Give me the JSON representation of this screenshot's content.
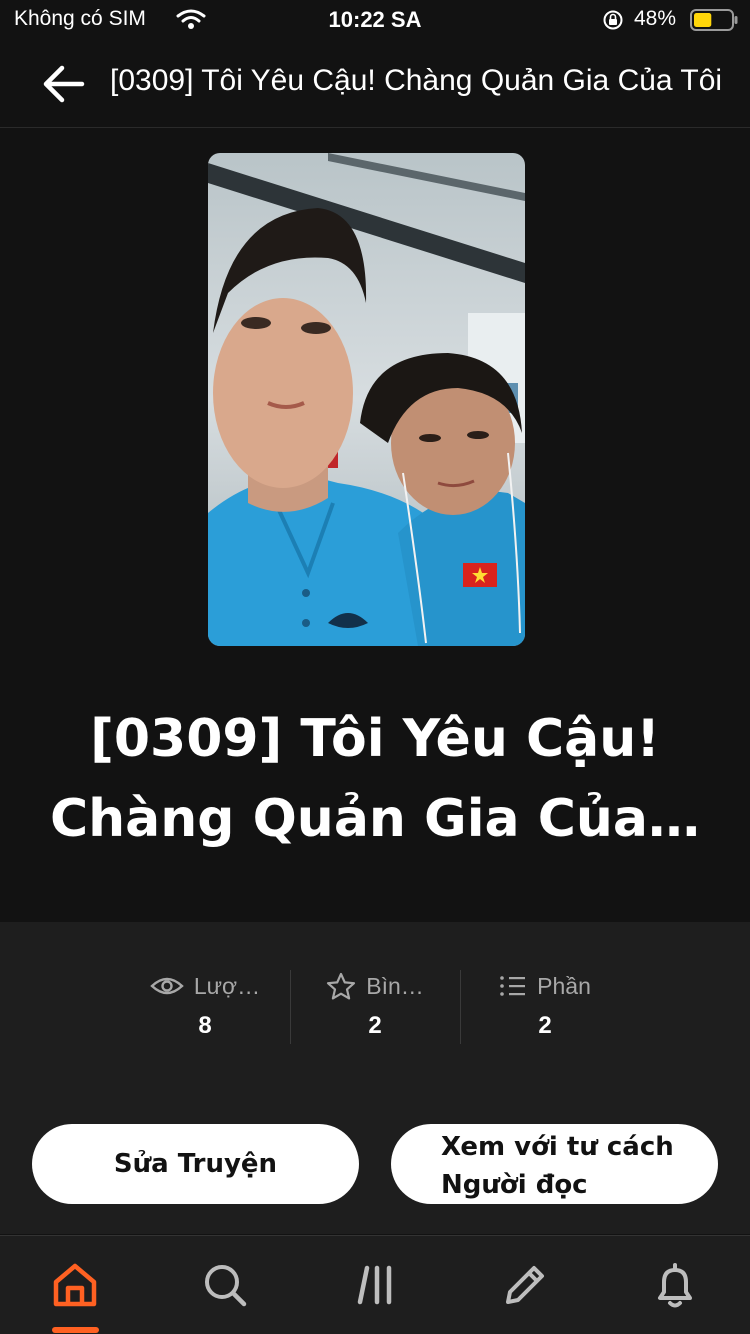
{
  "status_bar": {
    "carrier": "Không có SIM",
    "time": "10:22 SA",
    "battery_percent": "48%",
    "battery_level": 0.48,
    "battery_color": "#ffd60a"
  },
  "nav": {
    "title": "[0309] Tôi Yêu Cậu! Chàng Quản Gia Của Tôi",
    "back_icon": "arrow-left-icon"
  },
  "story": {
    "title_line1": "[0309] Tôi Yêu Cậu!",
    "title_line2": "Chàng Quản Gia Của…"
  },
  "stats": [
    {
      "icon": "eye-icon",
      "label": "Lượ…",
      "value": "8"
    },
    {
      "icon": "star-icon",
      "label": "Bìn…",
      "value": "2"
    },
    {
      "icon": "list-icon",
      "label": "Phần",
      "value": "2"
    }
  ],
  "actions": {
    "edit_label": "Sửa Truyện",
    "read_line1": "Xem với tư cách",
    "read_line2": "Người đọc"
  },
  "tabs": [
    {
      "name": "home",
      "icon": "home-icon",
      "active": true
    },
    {
      "name": "search",
      "icon": "search-icon",
      "active": false
    },
    {
      "name": "library",
      "icon": "library-icon",
      "active": false
    },
    {
      "name": "write",
      "icon": "pencil-icon",
      "active": false
    },
    {
      "name": "notifications",
      "icon": "bell-icon",
      "active": false
    }
  ],
  "colors": {
    "accent": "#ff6122",
    "background": "#121212",
    "panel": "#1e1e1e"
  }
}
